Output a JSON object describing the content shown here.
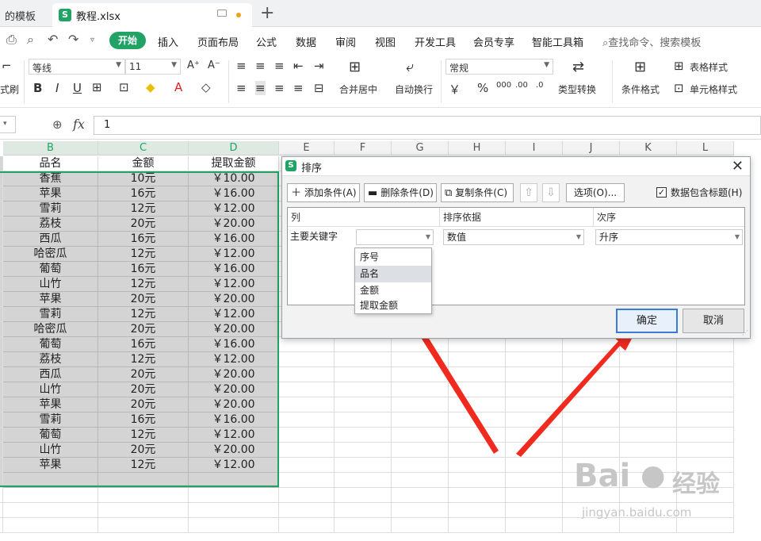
{
  "tabs": {
    "first": "的模板",
    "file": "教程.xlsx",
    "add": "+"
  },
  "menu": {
    "items": [
      "插入",
      "页面布局",
      "公式",
      "数据",
      "审阅",
      "视图",
      "开发工具",
      "会员专享",
      "智能工具箱"
    ],
    "active": "开始",
    "search": "查找命令、搜索模板"
  },
  "ribbon": {
    "format_brush": "式刷",
    "font_name": "等线",
    "font_size": "11",
    "bold": "B",
    "italic": "I",
    "underline": "U",
    "merge": "合并居中",
    "wrap": "自动换行",
    "number_format": "常规",
    "type_convert": "类型转换",
    "cond_format": "条件格式",
    "table_style": "表格样式",
    "cell_style": "单元格样式"
  },
  "formula": {
    "fx": "fx",
    "value": "1"
  },
  "columns": [
    "B",
    "C",
    "D",
    "E",
    "F",
    "G",
    "H",
    "I",
    "J",
    "K",
    "L"
  ],
  "headers": [
    "品名",
    "金额",
    "提取金额"
  ],
  "rows": [
    [
      "香蕉",
      "10元",
      "￥10.00"
    ],
    [
      "苹果",
      "16元",
      "￥16.00"
    ],
    [
      "雪莉",
      "12元",
      "￥12.00"
    ],
    [
      "荔枝",
      "20元",
      "￥20.00"
    ],
    [
      "西瓜",
      "16元",
      "￥16.00"
    ],
    [
      "哈密瓜",
      "12元",
      "￥12.00"
    ],
    [
      "葡萄",
      "16元",
      "￥16.00"
    ],
    [
      "山竹",
      "12元",
      "￥12.00"
    ],
    [
      "苹果",
      "20元",
      "￥20.00"
    ],
    [
      "雪莉",
      "12元",
      "￥12.00"
    ],
    [
      "哈密瓜",
      "20元",
      "￥20.00"
    ],
    [
      "葡萄",
      "16元",
      "￥16.00"
    ],
    [
      "荔枝",
      "12元",
      "￥12.00"
    ],
    [
      "西瓜",
      "20元",
      "￥20.00"
    ],
    [
      "山竹",
      "20元",
      "￥20.00"
    ],
    [
      "苹果",
      "20元",
      "￥20.00"
    ],
    [
      "雪莉",
      "16元",
      "￥16.00"
    ],
    [
      "葡萄",
      "12元",
      "￥12.00"
    ],
    [
      "山竹",
      "20元",
      "￥20.00"
    ],
    [
      "苹果",
      "12元",
      "￥12.00"
    ]
  ],
  "dialog": {
    "title": "排序",
    "add": "添加条件(A)",
    "delete": "删除条件(D)",
    "copy": "复制条件(C)",
    "options": "选项(O)...",
    "header_check": "数据包含标题(H)",
    "col_header": "列",
    "sortby_header": "排序依据",
    "order_header": "次序",
    "key_label": "主要关键字",
    "key_value": "",
    "sortby_value": "数值",
    "order_value": "升序",
    "options_list": [
      "序号",
      "品名",
      "金额",
      "提取金额"
    ],
    "ok": "确定",
    "cancel": "取消"
  },
  "watermark": {
    "brand": "Bai",
    "brand2": "经验",
    "url": "jingyan.baidu.com"
  },
  "colors": {
    "accent": "#21a366",
    "arrow": "#f02a1e",
    "selection": "#d4d4d4"
  }
}
